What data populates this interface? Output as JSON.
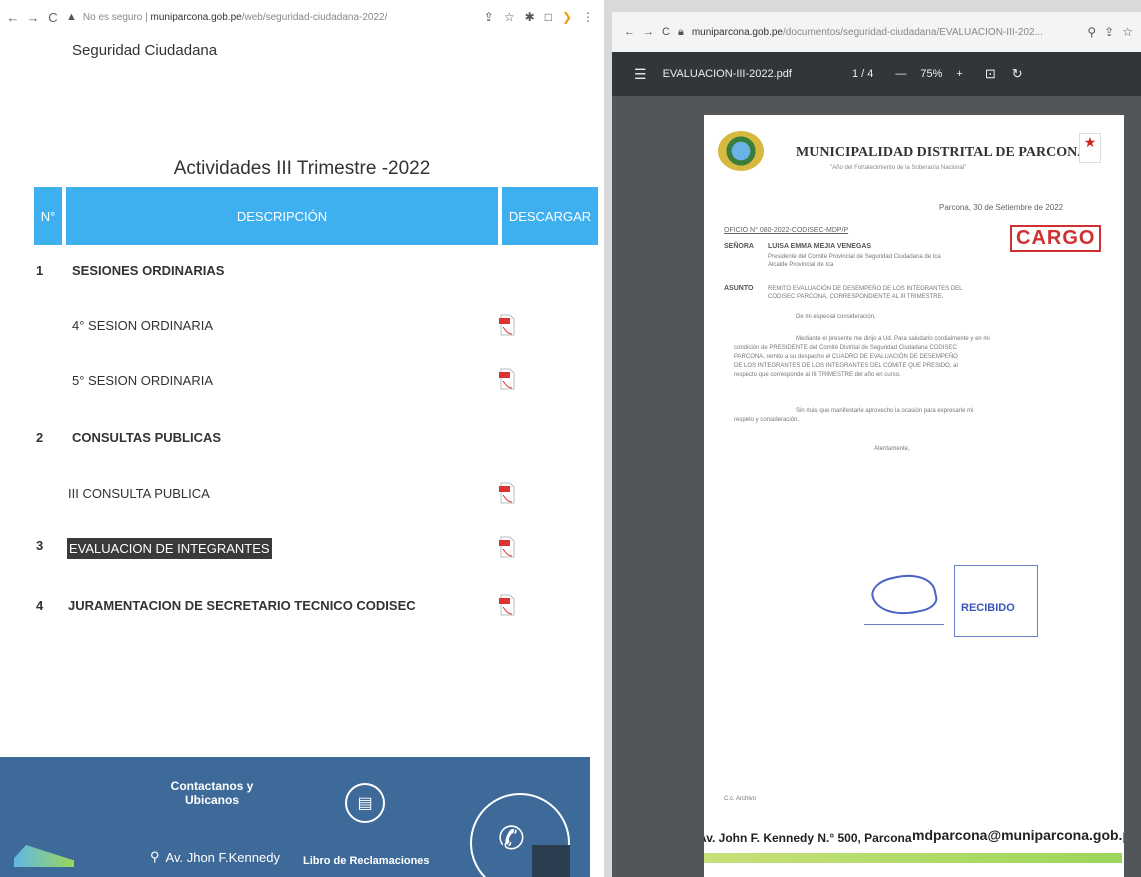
{
  "left": {
    "address_bar": {
      "security": "No es seguro",
      "url_host": "muniparcona.gob.pe",
      "url_path": "/web/seguridad-ciudadana-2022/"
    },
    "site_title": "Seguridad Ciudadana",
    "section_title": "Actividades III Trimestre -2022",
    "table": {
      "headers": {
        "num": "N°",
        "desc": "DESCRIPCIÓN",
        "download": "DESCARGAR"
      },
      "rows": [
        {
          "num": "1",
          "label": "SESIONES ORDINARIAS"
        },
        {
          "num": "",
          "label": "4° SESION ORDINARIA"
        },
        {
          "num": "",
          "label": "5° SESION ORDINARIA"
        },
        {
          "num": "2",
          "label": "CONSULTAS PUBLICAS"
        },
        {
          "num": "",
          "label": "III CONSULTA PUBLICA"
        },
        {
          "num": "3",
          "label": "EVALUACION DE INTEGRANTES"
        },
        {
          "num": "4",
          "label": "JURAMENTACION DE SECRETARIO TECNICO CODISEC"
        }
      ]
    },
    "footer": {
      "contact": "Contactanos y Ubicanos",
      "address": "Av. Jhon F.Kennedy",
      "libro": "Libro de Reclamaciones"
    }
  },
  "right": {
    "address_bar": {
      "url_host": "muniparcona.gob.pe",
      "url_path": "/documentos/seguridad-ciudadana/EVALUACION-III-202..."
    },
    "pdf": {
      "filename": "EVALUACION-III-2022.pdf",
      "pages": "1 / 4",
      "zoom": "75%",
      "minus": "—",
      "plus": "+"
    },
    "doc": {
      "org": "MUNICIPALIDAD DISTRITAL DE PARCONA",
      "motto": "\"Año del Fortalecimiento de la Soberanía Nacional\"",
      "date": "Parcona, 30 de Setiembre de 2022",
      "oficio": "OFICIO N° 080-2022-CODISEC-MDP/P",
      "cargo": "CARGO",
      "senora_label": "SEÑORA",
      "senora_name": "LUISA EMMA MEJIA VENEGAS",
      "senora_role1": "Presidente del Comité Provincial de Seguridad Ciudadana de Ica",
      "senora_role2": "Alcalde Provincial de Ica",
      "asunto_label": "ASUNTO",
      "asunto_text1": "REMITO EVALUACIÓN DE DESEMPEÑO DE LOS INTEGRANTES DEL",
      "asunto_text2": "CODISEC PARCONA, CORRESPONDIENTE AL III TRIMESTRE.",
      "greet": "De mi especial consideración,",
      "body1": "Mediante el presente me dirijo a Ud. Para saludarlo cordialmente y en mi",
      "body2": "condición de PRESIDENTE del Comité Distrital de Seguridad Ciudadana CODISEC",
      "body3": "PARCONA, remito a su despacho el CUADRO DE EVALUACIÓN DE DESEMPEÑO",
      "body4": "DE LOS INTEGRANTES DE LOS INTEGRANTES DEL COMITE QUE PRESIDO, al",
      "body5": "respecto que corresponde al III TRIMESTRE del año en curso.",
      "closing1": "Sin más que manifestarle aprovecho la ocasión para expresarle mi",
      "closing2": "respeto y consideración.",
      "atte": "Atentamente,",
      "recibido": "RECIBIDO",
      "cc": "C.c. Archivo",
      "foot_address": "Av. John F. Kennedy  N.° 500, Parcona",
      "foot_email": "mdparcona@muniparcona.gob.pe"
    }
  }
}
